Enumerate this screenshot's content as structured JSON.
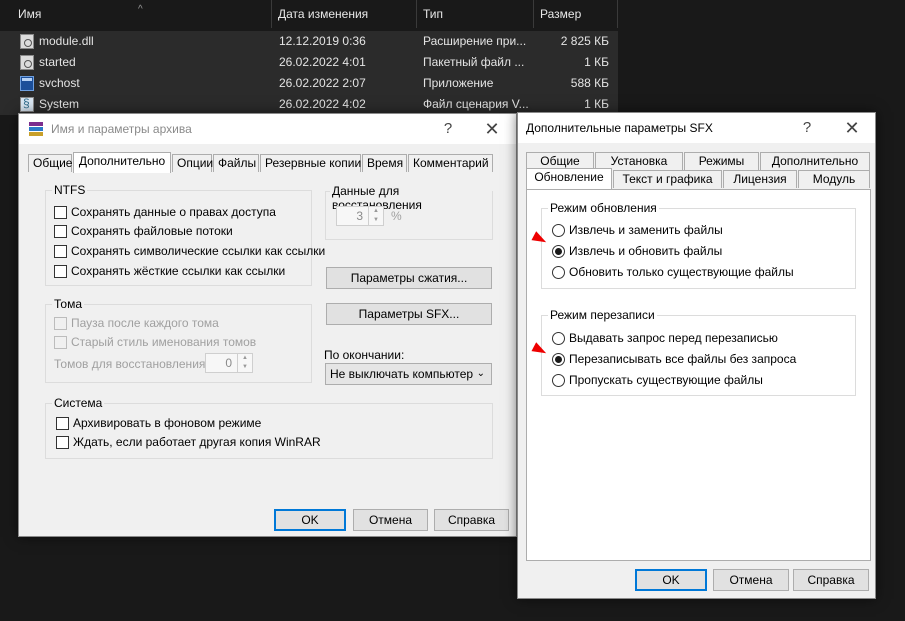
{
  "explorer": {
    "columns": [
      "Имя",
      "Дата изменения",
      "Тип",
      "Размер"
    ],
    "files": [
      {
        "name": "module.dll",
        "date": "12.12.2019 0:36",
        "type": "Расширение при...",
        "size": "2 825 КБ",
        "icon": "settings-file-icon"
      },
      {
        "name": "started",
        "date": "26.02.2022 4:01",
        "type": "Пакетный файл ...",
        "size": "1 КБ",
        "icon": "batch-file-icon"
      },
      {
        "name": "svchost",
        "date": "26.02.2022 2:07",
        "type": "Приложение",
        "size": "588 КБ",
        "icon": "application-icon"
      },
      {
        "name": "System",
        "date": "26.02.2022 4:02",
        "type": "Файл сценария V...",
        "size": "1 КБ",
        "icon": "script-file-icon"
      }
    ]
  },
  "archive_dialog": {
    "title": "Имя и параметры архива",
    "help": "?",
    "close": "✕",
    "tabs": [
      "Общие",
      "Дополнительно",
      "Опции",
      "Файлы",
      "Резервные копии",
      "Время",
      "Комментарий"
    ],
    "ntfs": {
      "title": "NTFS",
      "items": [
        "Сохранять данные о правах доступа",
        "Сохранять файловые потоки",
        "Сохранять символические ссылки как ссылки",
        "Сохранять жёсткие ссылки как ссылки"
      ]
    },
    "recovery": {
      "title": "Данные для восстановления",
      "value": "3",
      "unit": "%"
    },
    "compression_button": "Параметры сжатия...",
    "sfx_button": "Параметры SFX...",
    "volumes": {
      "title": "Тома",
      "items": [
        "Пауза после каждого тома",
        "Старый стиль именования томов"
      ],
      "recovery_label": "Томов для восстановления:",
      "recovery_value": "0"
    },
    "on_finish": {
      "label": "По окончании:",
      "value": "Не выключать компьютер"
    },
    "system": {
      "title": "Система",
      "items": [
        "Архивировать в фоновом режиме",
        "Ждать, если работает другая копия WinRAR"
      ]
    },
    "buttons": {
      "ok": "OK",
      "cancel": "Отмена",
      "help": "Справка"
    }
  },
  "sfx_dialog": {
    "title": "Дополнительные параметры SFX",
    "help": "?",
    "close": "✕",
    "tabs_row1": [
      "Общие",
      "Установка",
      "Режимы",
      "Дополнительно"
    ],
    "tabs_row2": [
      "Обновление",
      "Текст и графика",
      "Лицензия",
      "Модуль"
    ],
    "update_mode": {
      "title": "Режим обновления",
      "options": [
        "Извлечь и заменить файлы",
        "Извлечь и обновить файлы",
        "Обновить только существующие файлы"
      ],
      "selected": 1
    },
    "overwrite_mode": {
      "title": "Режим перезаписи",
      "options": [
        "Выдавать запрос перед перезаписью",
        "Перезаписывать все файлы без запроса",
        "Пропускать существующие файлы"
      ],
      "selected": 1
    },
    "buttons": {
      "ok": "OK",
      "cancel": "Отмена",
      "help": "Справка"
    }
  },
  "colors": {
    "arrow": "#e00000",
    "accent": "#0078d7"
  }
}
